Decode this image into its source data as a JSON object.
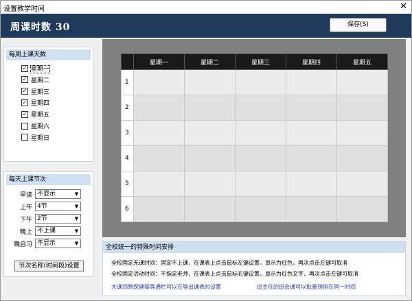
{
  "window": {
    "title": "设置教学时间",
    "close_glyph": "✕"
  },
  "header": {
    "title": "周课时数  30",
    "save_label": "保存(S)"
  },
  "weekdays_panel": {
    "title": "每周上课天数",
    "days": [
      {
        "label": "星期一",
        "checked": true
      },
      {
        "label": "星期二",
        "checked": true
      },
      {
        "label": "星期三",
        "checked": true
      },
      {
        "label": "星期四",
        "checked": true
      },
      {
        "label": "星期五",
        "checked": true
      },
      {
        "label": "星期六",
        "checked": false
      },
      {
        "label": "星期日",
        "checked": false
      }
    ]
  },
  "periods_panel": {
    "title": "每天上课节次",
    "rows": [
      {
        "label": "早读",
        "value": "不显示"
      },
      {
        "label": "上午",
        "value": "4节"
      },
      {
        "label": "下午",
        "value": "2节"
      },
      {
        "label": "晚上",
        "value": "不上课"
      },
      {
        "label": "晚自习",
        "value": "不显示"
      }
    ],
    "button_label": "节次名称(时间段)设置"
  },
  "timetable": {
    "headers": [
      "星期一",
      "星期二",
      "星期三",
      "星期四",
      "星期五"
    ],
    "rows": [
      "1",
      "2",
      "3",
      "4",
      "5",
      "6"
    ]
  },
  "special": {
    "title": "全校统一的特殊时间安排",
    "line1": "全校固定无课时间：固定不上课，在课表上点击鼠标左键设置，显示为红色，再次点击左键可取消",
    "line2": "全校固定活动时间：不指定老师，在课表上点击鼠标右键设置，显示为红色文字，再次点击左键可取消",
    "note1": "大课间眼保健操等通栏可以在导出课表时设置",
    "note2": "班主任的班会课可以批量预排在同一时间"
  },
  "colors": {
    "header_bg": "#1f3a5a",
    "grid_bg": "#808080",
    "panel_header": "#cfe0f2",
    "link_blue": "#2a3aa8"
  }
}
